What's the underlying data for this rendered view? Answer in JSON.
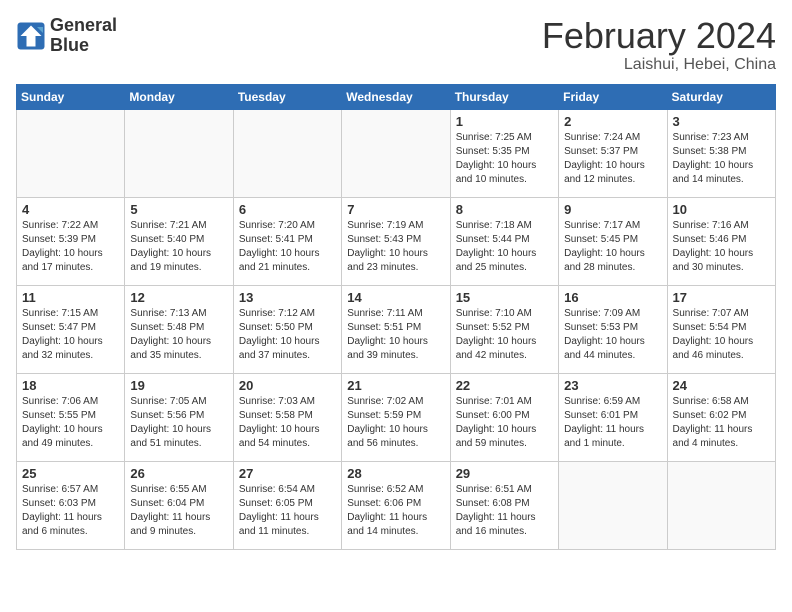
{
  "header": {
    "logo_line1": "General",
    "logo_line2": "Blue",
    "title": "February 2024",
    "subtitle": "Laishui, Hebei, China"
  },
  "weekdays": [
    "Sunday",
    "Monday",
    "Tuesday",
    "Wednesday",
    "Thursday",
    "Friday",
    "Saturday"
  ],
  "weeks": [
    [
      {
        "day": "",
        "info": ""
      },
      {
        "day": "",
        "info": ""
      },
      {
        "day": "",
        "info": ""
      },
      {
        "day": "",
        "info": ""
      },
      {
        "day": "1",
        "info": "Sunrise: 7:25 AM\nSunset: 5:35 PM\nDaylight: 10 hours\nand 10 minutes."
      },
      {
        "day": "2",
        "info": "Sunrise: 7:24 AM\nSunset: 5:37 PM\nDaylight: 10 hours\nand 12 minutes."
      },
      {
        "day": "3",
        "info": "Sunrise: 7:23 AM\nSunset: 5:38 PM\nDaylight: 10 hours\nand 14 minutes."
      }
    ],
    [
      {
        "day": "4",
        "info": "Sunrise: 7:22 AM\nSunset: 5:39 PM\nDaylight: 10 hours\nand 17 minutes."
      },
      {
        "day": "5",
        "info": "Sunrise: 7:21 AM\nSunset: 5:40 PM\nDaylight: 10 hours\nand 19 minutes."
      },
      {
        "day": "6",
        "info": "Sunrise: 7:20 AM\nSunset: 5:41 PM\nDaylight: 10 hours\nand 21 minutes."
      },
      {
        "day": "7",
        "info": "Sunrise: 7:19 AM\nSunset: 5:43 PM\nDaylight: 10 hours\nand 23 minutes."
      },
      {
        "day": "8",
        "info": "Sunrise: 7:18 AM\nSunset: 5:44 PM\nDaylight: 10 hours\nand 25 minutes."
      },
      {
        "day": "9",
        "info": "Sunrise: 7:17 AM\nSunset: 5:45 PM\nDaylight: 10 hours\nand 28 minutes."
      },
      {
        "day": "10",
        "info": "Sunrise: 7:16 AM\nSunset: 5:46 PM\nDaylight: 10 hours\nand 30 minutes."
      }
    ],
    [
      {
        "day": "11",
        "info": "Sunrise: 7:15 AM\nSunset: 5:47 PM\nDaylight: 10 hours\nand 32 minutes."
      },
      {
        "day": "12",
        "info": "Sunrise: 7:13 AM\nSunset: 5:48 PM\nDaylight: 10 hours\nand 35 minutes."
      },
      {
        "day": "13",
        "info": "Sunrise: 7:12 AM\nSunset: 5:50 PM\nDaylight: 10 hours\nand 37 minutes."
      },
      {
        "day": "14",
        "info": "Sunrise: 7:11 AM\nSunset: 5:51 PM\nDaylight: 10 hours\nand 39 minutes."
      },
      {
        "day": "15",
        "info": "Sunrise: 7:10 AM\nSunset: 5:52 PM\nDaylight: 10 hours\nand 42 minutes."
      },
      {
        "day": "16",
        "info": "Sunrise: 7:09 AM\nSunset: 5:53 PM\nDaylight: 10 hours\nand 44 minutes."
      },
      {
        "day": "17",
        "info": "Sunrise: 7:07 AM\nSunset: 5:54 PM\nDaylight: 10 hours\nand 46 minutes."
      }
    ],
    [
      {
        "day": "18",
        "info": "Sunrise: 7:06 AM\nSunset: 5:55 PM\nDaylight: 10 hours\nand 49 minutes."
      },
      {
        "day": "19",
        "info": "Sunrise: 7:05 AM\nSunset: 5:56 PM\nDaylight: 10 hours\nand 51 minutes."
      },
      {
        "day": "20",
        "info": "Sunrise: 7:03 AM\nSunset: 5:58 PM\nDaylight: 10 hours\nand 54 minutes."
      },
      {
        "day": "21",
        "info": "Sunrise: 7:02 AM\nSunset: 5:59 PM\nDaylight: 10 hours\nand 56 minutes."
      },
      {
        "day": "22",
        "info": "Sunrise: 7:01 AM\nSunset: 6:00 PM\nDaylight: 10 hours\nand 59 minutes."
      },
      {
        "day": "23",
        "info": "Sunrise: 6:59 AM\nSunset: 6:01 PM\nDaylight: 11 hours\nand 1 minute."
      },
      {
        "day": "24",
        "info": "Sunrise: 6:58 AM\nSunset: 6:02 PM\nDaylight: 11 hours\nand 4 minutes."
      }
    ],
    [
      {
        "day": "25",
        "info": "Sunrise: 6:57 AM\nSunset: 6:03 PM\nDaylight: 11 hours\nand 6 minutes."
      },
      {
        "day": "26",
        "info": "Sunrise: 6:55 AM\nSunset: 6:04 PM\nDaylight: 11 hours\nand 9 minutes."
      },
      {
        "day": "27",
        "info": "Sunrise: 6:54 AM\nSunset: 6:05 PM\nDaylight: 11 hours\nand 11 minutes."
      },
      {
        "day": "28",
        "info": "Sunrise: 6:52 AM\nSunset: 6:06 PM\nDaylight: 11 hours\nand 14 minutes."
      },
      {
        "day": "29",
        "info": "Sunrise: 6:51 AM\nSunset: 6:08 PM\nDaylight: 11 hours\nand 16 minutes."
      },
      {
        "day": "",
        "info": ""
      },
      {
        "day": "",
        "info": ""
      }
    ]
  ]
}
